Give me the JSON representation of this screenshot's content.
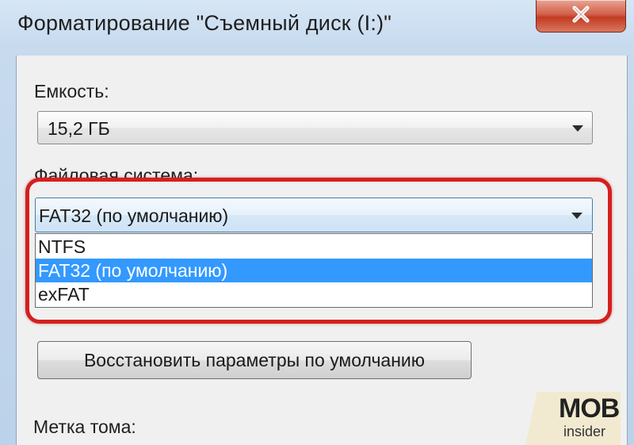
{
  "window": {
    "title": "Форматирование \"Съемный диск (I:)\""
  },
  "capacity": {
    "label": "Емкость:",
    "value": "15,2 ГБ"
  },
  "file_system": {
    "label": "Файловая система:",
    "value": "FAT32 (по умолчанию)",
    "options": [
      "NTFS",
      "FAT32 (по умолчанию)",
      "exFAT"
    ],
    "selected_index": 1
  },
  "restore_button": {
    "label": "Восстановить параметры по умолчанию"
  },
  "volume_label": {
    "label": "Метка тома:"
  },
  "logo": {
    "main": "MOBI",
    "sub": "insider"
  },
  "colors": {
    "highlight_ring": "#d61f1f",
    "selection": "#3399ff",
    "close_button": "#c23b22"
  }
}
